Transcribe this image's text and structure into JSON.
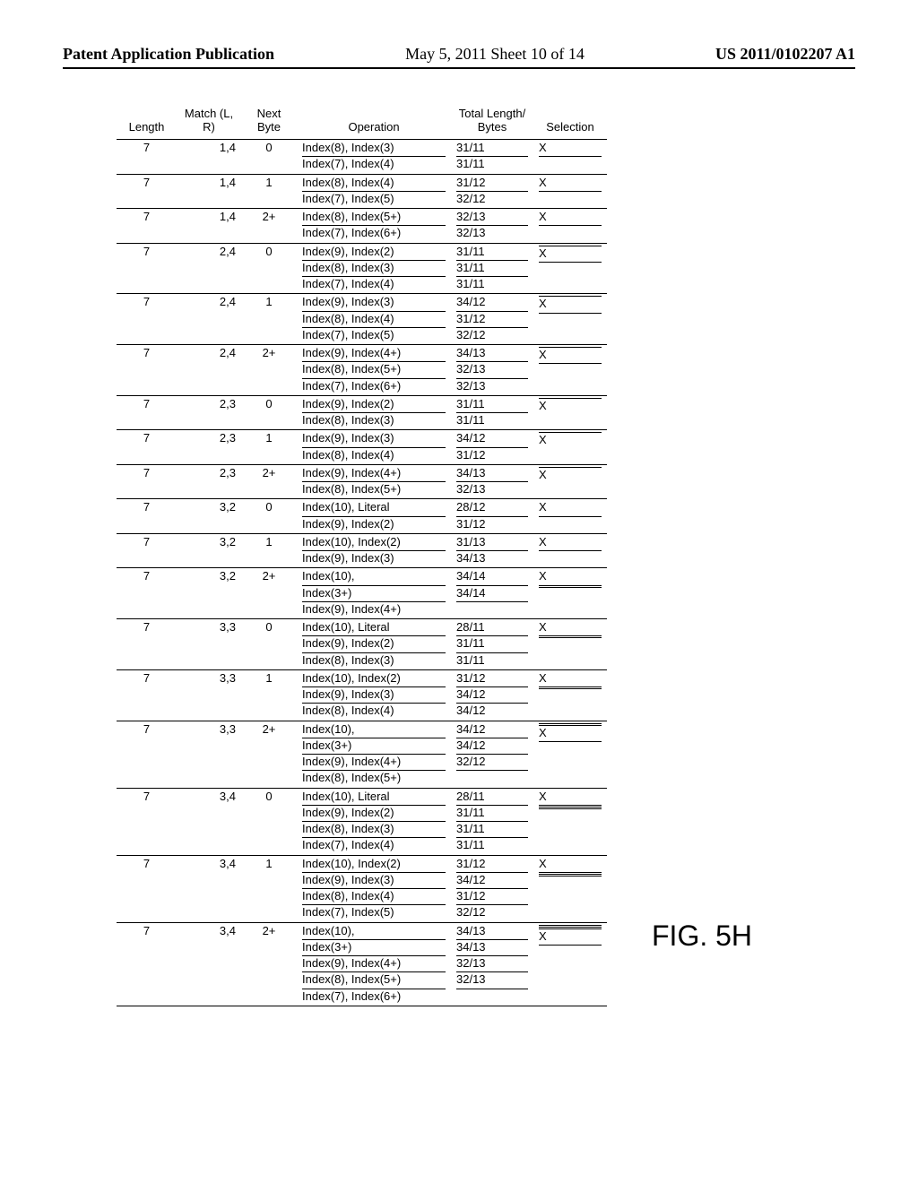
{
  "header": {
    "left": "Patent Application Publication",
    "center": "May 5, 2011  Sheet 10 of 14",
    "right": "US 2011/0102207 A1"
  },
  "figure_label": "FIG. 5H",
  "table": {
    "headers": {
      "length": "Length",
      "match": "Match\n(L, R)",
      "next": "Next\nByte",
      "operation": "Operation",
      "total": "Total Length/\nBytes",
      "selection": "Selection"
    },
    "rows": [
      {
        "length": "7",
        "match": "1,4",
        "next": "0",
        "ops": [
          "Index(8), Index(3)",
          "Index(7), Index(4)"
        ],
        "tots": [
          "31/11",
          "31/11"
        ],
        "sels": [
          "X",
          ""
        ]
      },
      {
        "length": "7",
        "match": "1,4",
        "next": "1",
        "ops": [
          "Index(8), Index(4)",
          "Index(7), Index(5)"
        ],
        "tots": [
          "31/12",
          "32/12"
        ],
        "sels": [
          "X",
          ""
        ]
      },
      {
        "length": "7",
        "match": "1,4",
        "next": "2+",
        "ops": [
          "Index(8), Index(5+)",
          "Index(7), Index(6+)"
        ],
        "tots": [
          "32/13",
          "32/13"
        ],
        "sels": [
          "X",
          ""
        ]
      },
      {
        "length": "7",
        "match": "2,4",
        "next": "0",
        "ops": [
          "Index(9), Index(2)",
          "Index(8), Index(3)",
          "Index(7), Index(4)"
        ],
        "tots": [
          "31/11",
          "31/11",
          "31/11"
        ],
        "sels": [
          "",
          "X",
          ""
        ]
      },
      {
        "length": "7",
        "match": "2,4",
        "next": "1",
        "ops": [
          "Index(9), Index(3)",
          "Index(8), Index(4)",
          "Index(7), Index(5)"
        ],
        "tots": [
          "34/12",
          "31/12",
          "32/12"
        ],
        "sels": [
          "",
          "X",
          ""
        ]
      },
      {
        "length": "7",
        "match": "2,4",
        "next": "2+",
        "ops": [
          "Index(9), Index(4+)",
          "Index(8), Index(5+)",
          "Index(7), Index(6+)"
        ],
        "tots": [
          "34/13",
          "32/13",
          "32/13"
        ],
        "sels": [
          "",
          "X",
          ""
        ]
      },
      {
        "length": "7",
        "match": "2,3",
        "next": "0",
        "ops": [
          "Index(9), Index(2)",
          "Index(8), Index(3)"
        ],
        "tots": [
          "31/11",
          "31/11"
        ],
        "sels": [
          "",
          "X"
        ]
      },
      {
        "length": "7",
        "match": "2,3",
        "next": "1",
        "ops": [
          "Index(9), Index(3)",
          "Index(8), Index(4)"
        ],
        "tots": [
          "34/12",
          "31/12"
        ],
        "sels": [
          "",
          "X"
        ]
      },
      {
        "length": "7",
        "match": "2,3",
        "next": "2+",
        "ops": [
          "Index(9), Index(4+)",
          "Index(8), Index(5+)"
        ],
        "tots": [
          "34/13",
          "32/13"
        ],
        "sels": [
          "",
          "X"
        ]
      },
      {
        "length": "7",
        "match": "3,2",
        "next": "0",
        "ops": [
          "Index(10), Literal",
          "Index(9), Index(2)"
        ],
        "tots": [
          "28/12",
          "31/12"
        ],
        "sels": [
          "X",
          ""
        ]
      },
      {
        "length": "7",
        "match": "3,2",
        "next": "1",
        "ops": [
          "Index(10), Index(2)",
          "Index(9), Index(3)"
        ],
        "tots": [
          "31/13",
          "34/13"
        ],
        "sels": [
          "X",
          ""
        ]
      },
      {
        "length": "7",
        "match": "3,2",
        "next": "2+",
        "ops": [
          "Index(10),",
          "Index(3+)",
          "Index(9), Index(4+)"
        ],
        "tots": [
          "34/14",
          "34/14",
          ""
        ],
        "sels": [
          "X",
          "",
          ""
        ]
      },
      {
        "length": "7",
        "match": "3,3",
        "next": "0",
        "ops": [
          "Index(10), Literal",
          "Index(9), Index(2)",
          "Index(8), Index(3)"
        ],
        "tots": [
          "28/11",
          "31/11",
          "31/11"
        ],
        "sels": [
          "X",
          "",
          ""
        ]
      },
      {
        "length": "7",
        "match": "3,3",
        "next": "1",
        "ops": [
          "Index(10), Index(2)",
          "Index(9), Index(3)",
          "Index(8), Index(4)"
        ],
        "tots": [
          "31/12",
          "34/12",
          "34/12"
        ],
        "sels": [
          "X",
          "",
          ""
        ]
      },
      {
        "length": "7",
        "match": "3,3",
        "next": "2+",
        "ops": [
          "Index(10),",
          "Index(3+)",
          "Index(9), Index(4+)",
          "Index(8), Index(5+)"
        ],
        "tots": [
          "34/12",
          "34/12",
          "32/12",
          ""
        ],
        "sels": [
          "",
          "",
          "X",
          ""
        ]
      },
      {
        "length": "7",
        "match": "3,4",
        "next": "0",
        "ops": [
          "Index(10), Literal",
          "Index(9), Index(2)",
          "Index(8), Index(3)",
          "Index(7), Index(4)"
        ],
        "tots": [
          "28/11",
          "31/11",
          "31/11",
          "31/11"
        ],
        "sels": [
          "X",
          "",
          "",
          ""
        ]
      },
      {
        "length": "7",
        "match": "3,4",
        "next": "1",
        "ops": [
          "Index(10), Index(2)",
          "Index(9), Index(3)",
          "Index(8), Index(4)",
          "Index(7), Index(5)"
        ],
        "tots": [
          "31/12",
          "34/12",
          "31/12",
          "32/12"
        ],
        "sels": [
          "X",
          "",
          "",
          ""
        ]
      },
      {
        "length": "7",
        "match": "3,4",
        "next": "2+",
        "ops": [
          "Index(10),",
          "Index(3+)",
          "Index(9), Index(4+)",
          "Index(8), Index(5+)",
          "Index(7), Index(6+)"
        ],
        "tots": [
          "34/13",
          "34/13",
          "32/13",
          "32/13",
          ""
        ],
        "sels": [
          "",
          "",
          "",
          "X",
          ""
        ]
      }
    ]
  }
}
